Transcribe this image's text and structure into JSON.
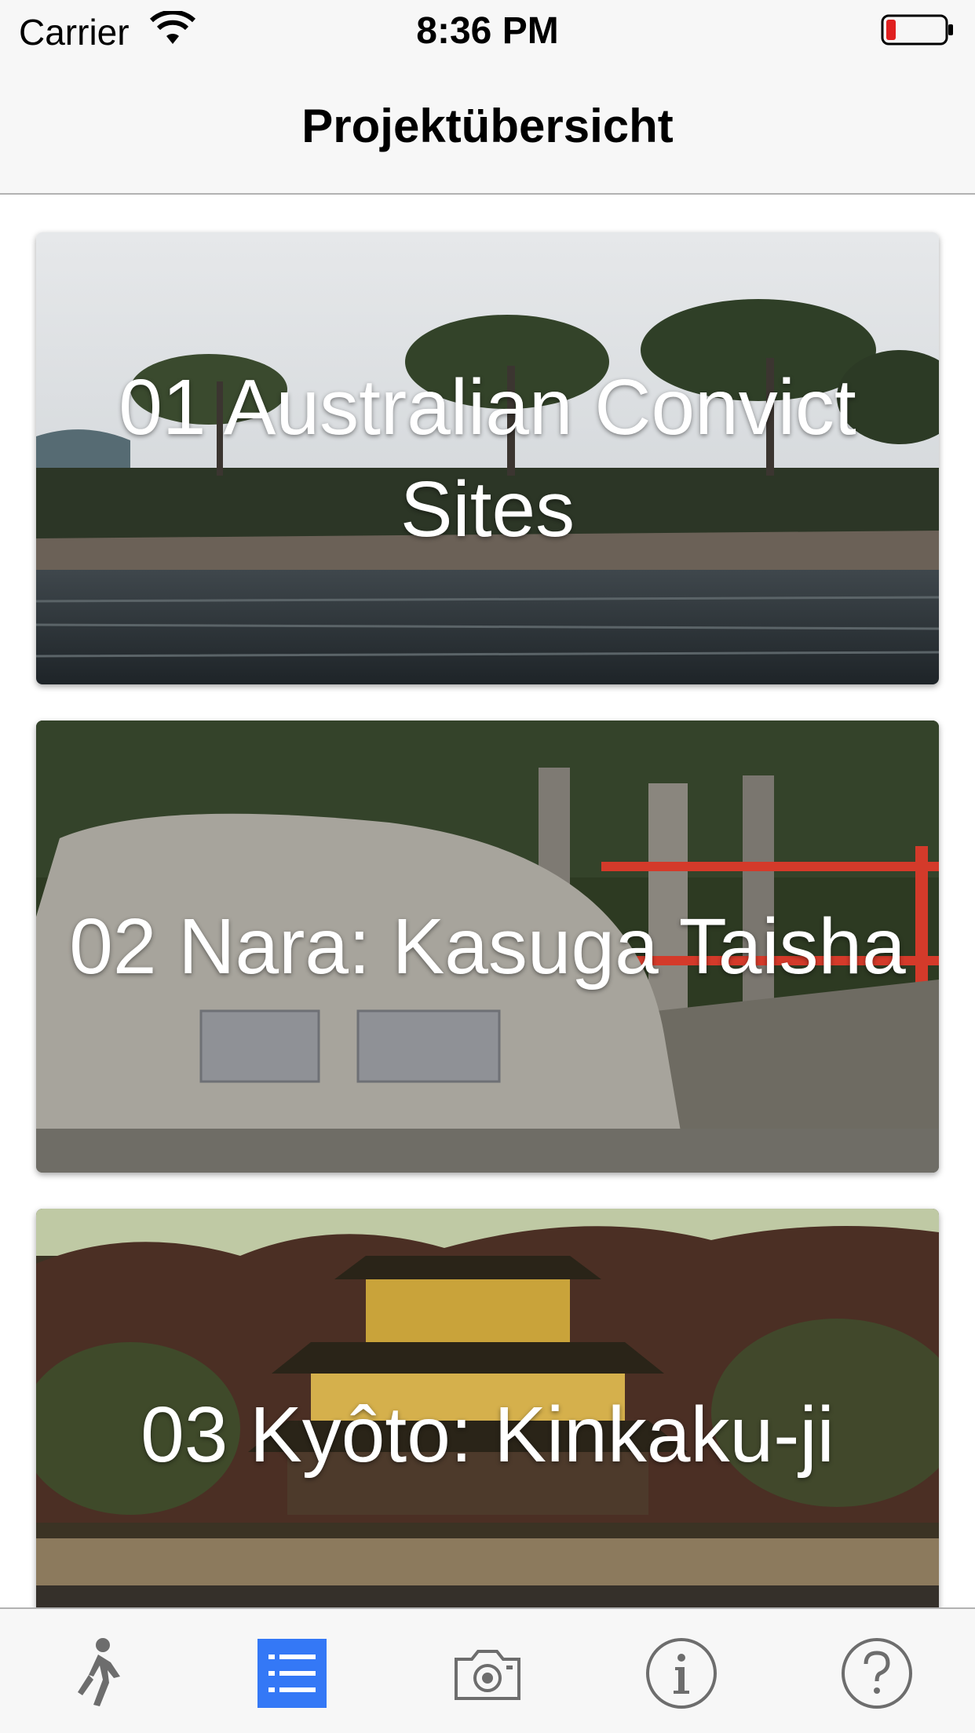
{
  "status_bar": {
    "carrier": "Carrier",
    "time": "8:36 PM",
    "icons": [
      "wifi-icon",
      "battery-low-icon"
    ],
    "battery_color": "#e02020"
  },
  "nav": {
    "title": "Projektübersicht"
  },
  "projects": [
    {
      "title": "01 Australian Convict Sites"
    },
    {
      "title": "02 Nara: Kasuga Taisha"
    },
    {
      "title": "03 Kyôto: Kinkaku-ji"
    }
  ],
  "tab_bar": {
    "tabs": [
      {
        "icon": "walking-person-icon",
        "selected": false
      },
      {
        "icon": "list-icon",
        "selected": true
      },
      {
        "icon": "camera-icon",
        "selected": false
      },
      {
        "icon": "info-icon",
        "selected": false
      },
      {
        "icon": "help-icon",
        "selected": false
      }
    ],
    "accent_color": "#3478f6",
    "inactive_color": "#6d6d6d"
  }
}
